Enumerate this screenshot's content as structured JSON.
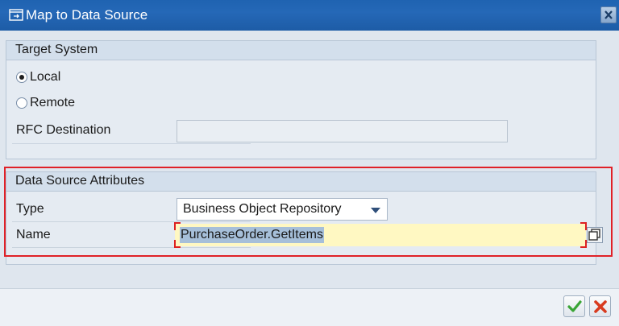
{
  "window": {
    "title": "Map to Data Source"
  },
  "target_system": {
    "header": "Target System",
    "local_label": "Local",
    "local_selected": true,
    "remote_label": "Remote",
    "remote_selected": false,
    "rfc_label": "RFC Destination",
    "rfc_value": ""
  },
  "data_source": {
    "header": "Data Source Attributes",
    "type_label": "Type",
    "type_value": "Business Object Repository",
    "name_label": "Name",
    "name_value": "PurchaseOrder.GetItems"
  },
  "colors": {
    "titlebar": "#2568b7",
    "highlight_frame": "#e02127",
    "name_field_bg": "#fff8c2",
    "ok_green": "#3aa536",
    "cancel_red": "#d83b1f"
  },
  "icons": [
    "window-icon",
    "close-icon",
    "dropdown-arrow-icon",
    "value-help-icon",
    "checkmark-icon",
    "cancel-x-icon"
  ]
}
